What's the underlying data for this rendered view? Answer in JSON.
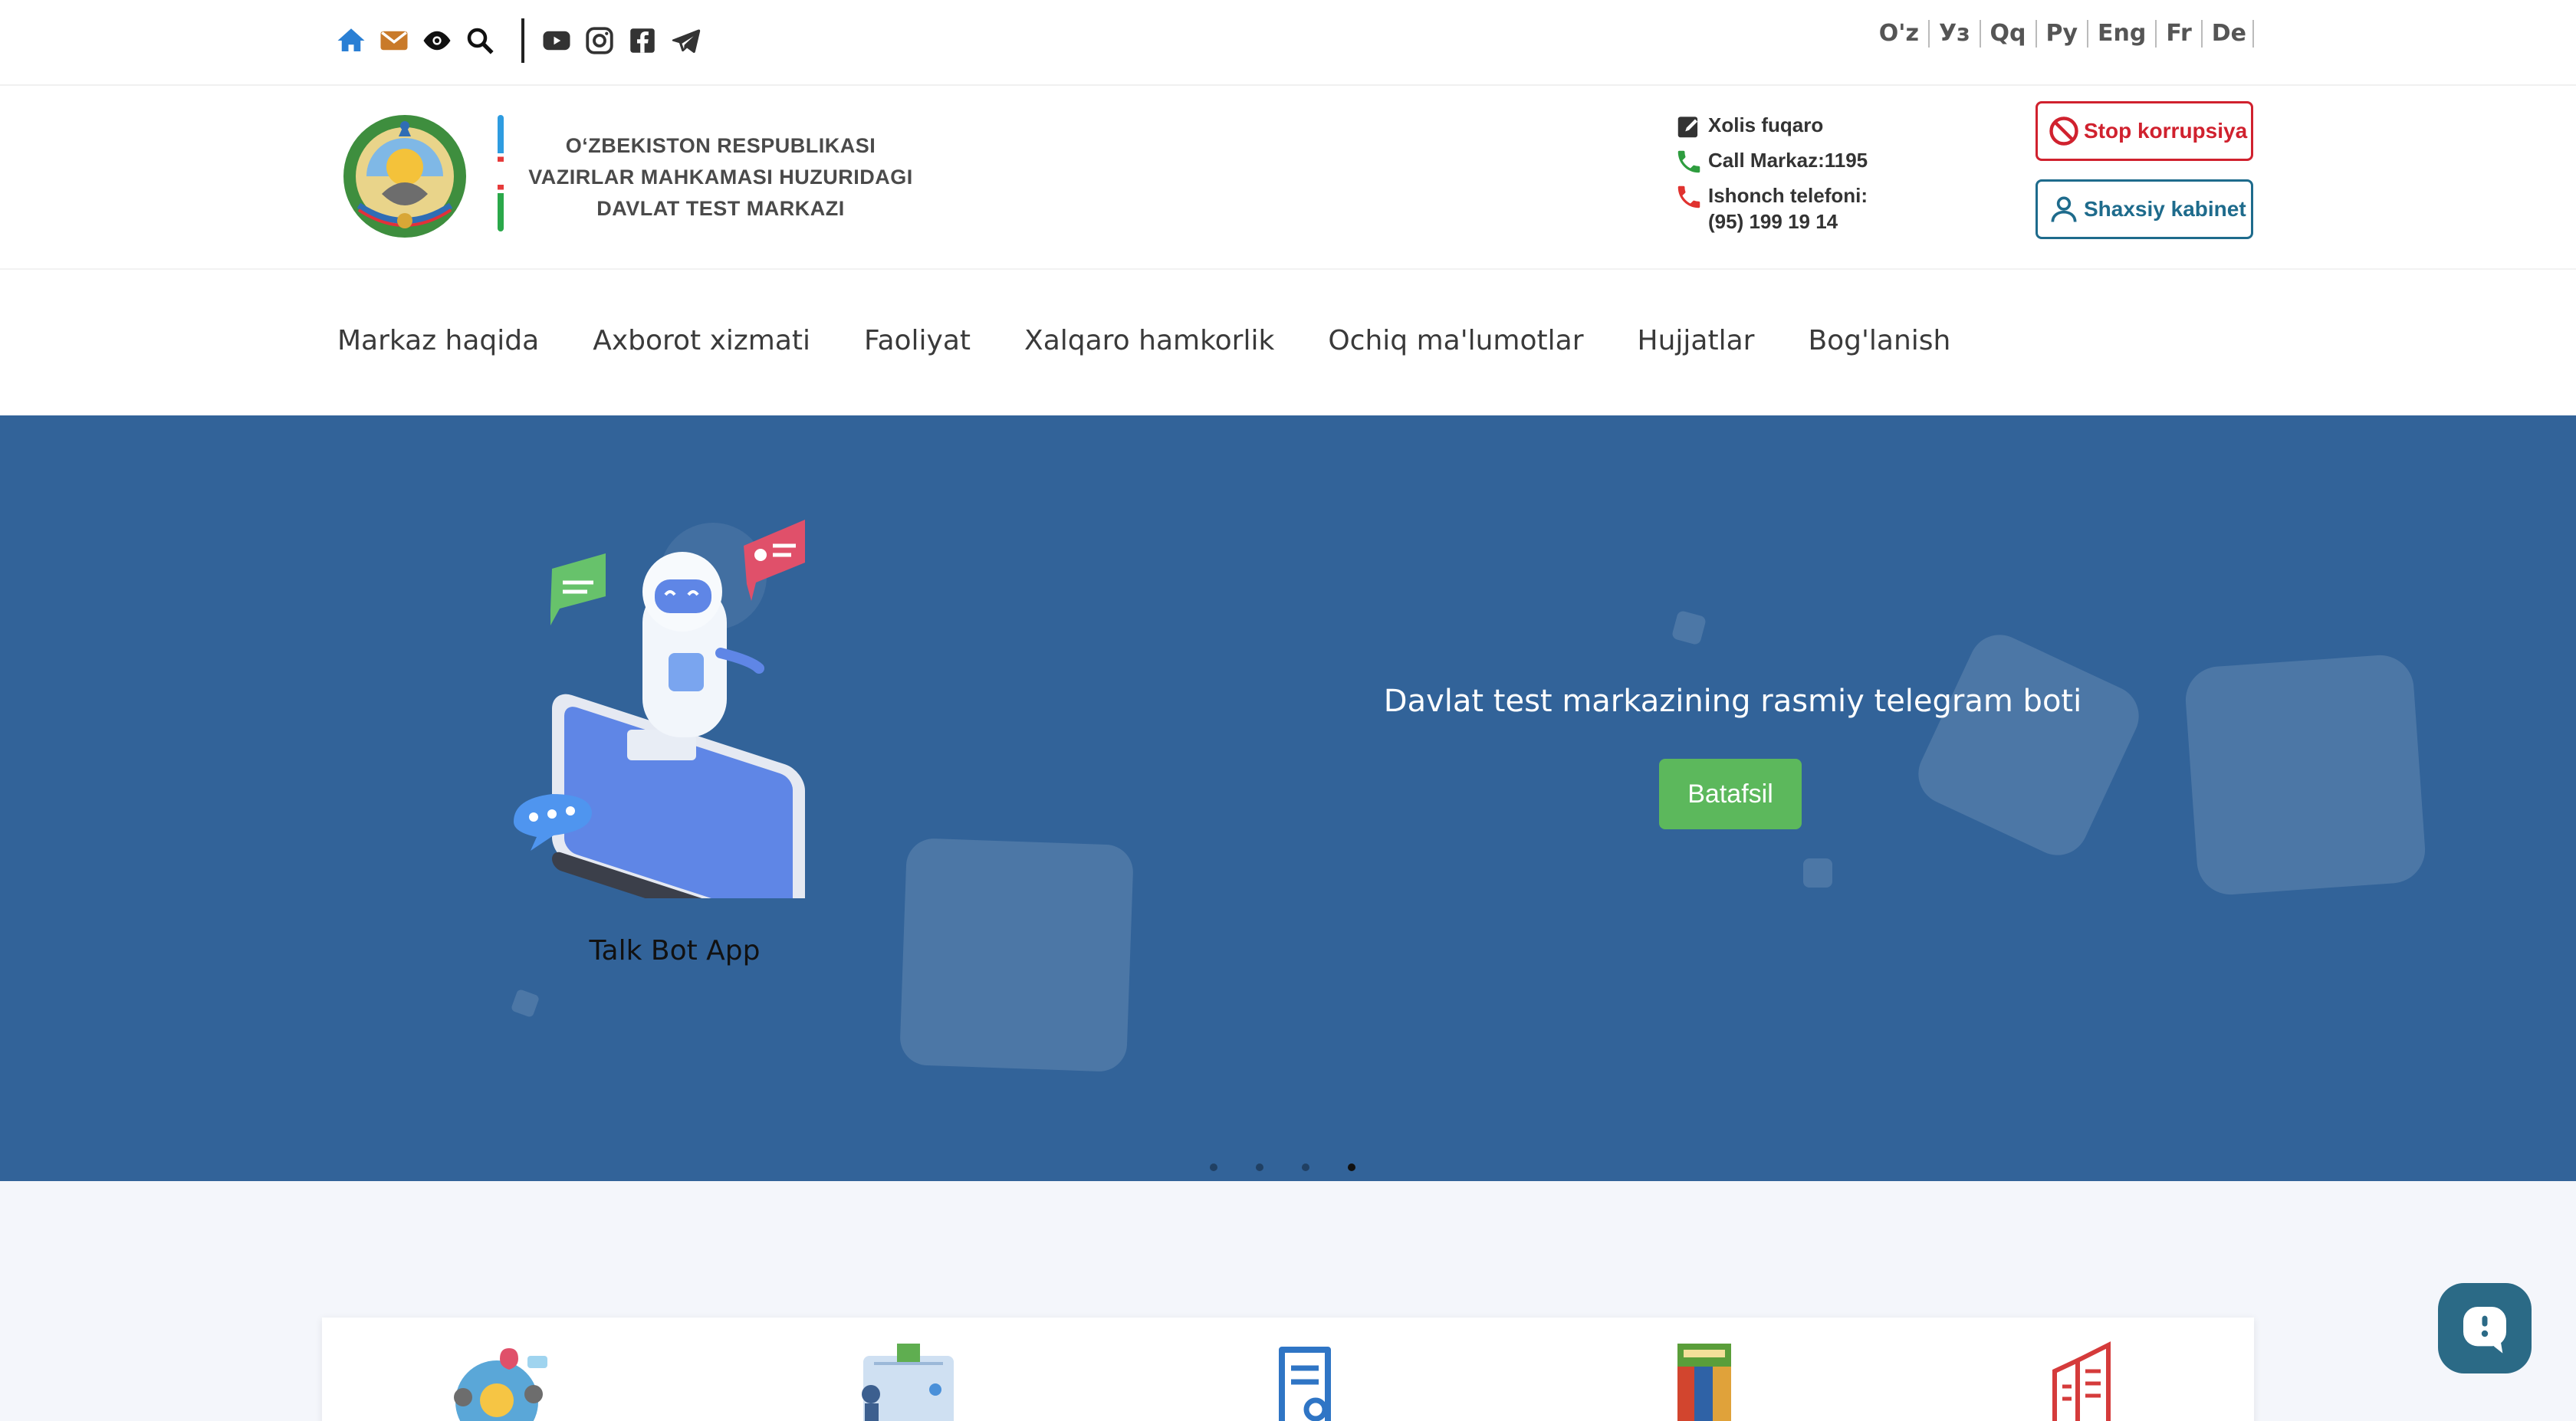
{
  "topbar": {
    "icons": [
      "home-icon",
      "mail-icon",
      "eye-icon",
      "search-icon",
      "youtube-icon",
      "instagram-icon",
      "facebook-icon",
      "telegram-icon"
    ],
    "languages": [
      "O'z",
      "Уз",
      "Qq",
      "Ру",
      "Eng",
      "Fr",
      "De"
    ]
  },
  "header": {
    "org_line1": "O‘ZBEKISTON RESPUBLIKASI",
    "org_line2": "VAZIRLAR MAHKAMASI HUZURIDAGI",
    "org_line3": "DAVLAT TEST MARKAZI",
    "contact_citizen": "Xolis fuqaro",
    "contact_call": "Call Markaz:1195",
    "contact_trust_label": "Ishonch telefoni:",
    "contact_trust_number": "(95) 199 19 14",
    "stop_button": "Stop korrupsiya",
    "cabinet_button": "Shaxsiy kabinet"
  },
  "nav": {
    "items": [
      "Markaz haqida",
      "Axborot xizmati",
      "Faoliyat",
      "Xalqaro hamkorlik",
      "Ochiq ma'lumotlar",
      "Hujjatlar",
      "Bog'lanish"
    ]
  },
  "hero": {
    "caption": "Talk Bot App",
    "title": "Davlat test markazining rasmiy telegram boti",
    "button": "Batafsil",
    "slides_count": 4,
    "active_slide": 4
  },
  "colors": {
    "hero_bg": "#326399",
    "accent_green": "#5cb85c",
    "stop_red": "#d0212e",
    "cabinet_teal": "#1e6b8c"
  }
}
